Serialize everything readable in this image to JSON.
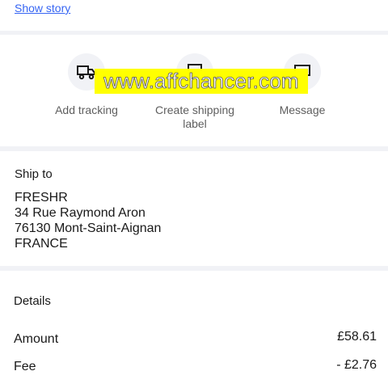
{
  "header": {
    "show_story_link": "Show story"
  },
  "actions": [
    {
      "label_line1": "Add tracking",
      "label_line2": "",
      "icon": "truck-icon"
    },
    {
      "label_line1": "Create shipping",
      "label_line2": "label",
      "icon": "label-icon"
    },
    {
      "label_line1": "Message",
      "label_line2": "",
      "icon": "message-icon"
    }
  ],
  "watermark": {
    "text": "www.affchancer.com"
  },
  "ship_to": {
    "title": "Ship to",
    "name": "FRESHR",
    "street": "34 Rue Raymond Aron",
    "city_line": "76130 Mont-Saint-Aignan",
    "country": "FRANCE"
  },
  "details": {
    "title": "Details",
    "rows": [
      {
        "label": "Amount",
        "value": "£58.61"
      },
      {
        "label": "Fee",
        "value": "- £2.76"
      }
    ]
  },
  "colors": {
    "link": "#3665f3",
    "divider": "#f1f2f6",
    "watermark_bg": "#ffff00"
  }
}
